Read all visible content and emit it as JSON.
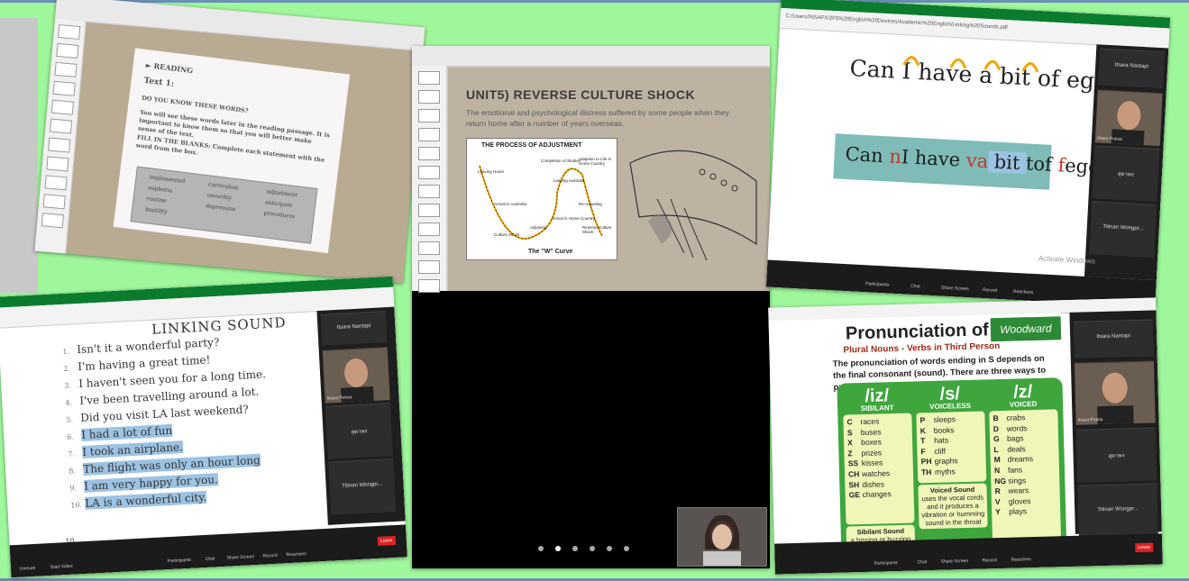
{
  "shot1": {
    "heading": "► READING",
    "text_label": "Text 1:",
    "q": "DO YOU KNOW THESE WORDS?",
    "intro": "You will see these words later in the reading passage. It is important to know them so that you will better make sense of the text.",
    "fill": "FILL IN THE BLANKS: Complete each statement with the word from the box.",
    "words": [
      "implemented",
      "curriculum",
      "adjustment",
      "euphoria",
      "smoothly",
      "anticipate",
      "routine",
      "depression",
      "procedures",
      "hostility"
    ]
  },
  "shot2": {
    "title": "UNIT5) REVERSE CULTURE SHOCK",
    "desc": "The emotional and psychological distress suffered by some people when they return home after a number of years overseas.",
    "diagram_title": "THE PROCESS OF ADJUSTMENT",
    "diagram_caption": "The \"W\" Curve",
    "diagram_labels": [
      "Leaving Home",
      "Arrival in Australia",
      "Adjusting",
      "Culture Shock",
      "Leaving Australia",
      "Arrival in Home Country",
      "Reverse Culture Shock",
      "Re-Adjusting",
      "Adaption to Life in Home Country",
      "Completion of Studies"
    ],
    "dots": 6,
    "active_dot": 1
  },
  "shot3": {
    "addr": "C:/Users/INSAFX/2F5%20English%20Devices/Academic%20English/Linking%20Sounds.pdf",
    "question": "Can I have a bit of egg?",
    "linked_parts": [
      "Can ",
      "n",
      "I have ",
      "va",
      " bit ",
      "tof ",
      "f",
      "egg?"
    ],
    "participants": [
      "Itsara Nantapi",
      "Itsara Puksa",
      "สุดาพร",
      "Titinan Wongpr..."
    ],
    "bottom": [
      "Participants",
      "Chat",
      "Share Screen",
      "Record",
      "Reactions"
    ],
    "watermark": "Activate Windows"
  },
  "shot4": {
    "title": "LINKING SOUND",
    "items": [
      {
        "n": "1.",
        "t": "Isn't it a wonderful party?"
      },
      {
        "n": "2.",
        "t": "I'm having a great time!"
      },
      {
        "n": "3.",
        "t": "I haven't seen you for a long time."
      },
      {
        "n": "4.",
        "t": "I've been travelling around a lot."
      },
      {
        "n": "5.",
        "t": "Did you visit LA last weekend?"
      },
      {
        "n": "6.",
        "t": "I had a lot of fun"
      },
      {
        "n": "7.",
        "t": "I took an airplane."
      },
      {
        "n": "8.",
        "t": "The flight was only an hour long"
      },
      {
        "n": "9.",
        "t": "I am very happy for you."
      },
      {
        "n": "10.",
        "t": "LA is a wonderful city."
      }
    ],
    "page": "10",
    "participants": [
      "Itsara Nantapi",
      "Itsara Puksa",
      "สุดาพร",
      "Titinan Wongpr..."
    ],
    "zoom_labels": [
      "Unmute",
      "Start Video",
      "Participants",
      "Chat",
      "Share Screen",
      "Record",
      "Reactions",
      "Leave"
    ]
  },
  "shot5": {
    "title": "Pronunciation of S",
    "subtitle": "Plural Nouns - Verbs in Third Person",
    "desc": "The pronunciation of words ending in S depends on the final consonant (sound). There are three ways to pronounce the S:",
    "badge": "Woodward",
    "cols": [
      {
        "sym": "/iz/",
        "label": "SIBILANT",
        "words": [
          [
            "C",
            "races"
          ],
          [
            "S",
            "buses"
          ],
          [
            "X",
            "boxes"
          ],
          [
            "Z",
            "prizes"
          ],
          [
            "SS",
            "kisses"
          ],
          [
            "CH",
            "watches"
          ],
          [
            "SH",
            "dishes"
          ],
          [
            "GE",
            "changes"
          ]
        ],
        "note_title": "Sibilant Sound",
        "note": "a hissing or buzzing sound"
      },
      {
        "sym": "/s/",
        "label": "VOICELESS",
        "words": [
          [
            "P",
            "sleeps"
          ],
          [
            "K",
            "books"
          ],
          [
            "T",
            "hats"
          ],
          [
            "F",
            "cliff"
          ],
          [
            "PH",
            "graphs"
          ],
          [
            "TH",
            "myths"
          ]
        ],
        "note_title": "Voiced Sound",
        "note": "uses the vocal cords and it produces a vibration or humming sound in the throat"
      },
      {
        "sym": "/z/",
        "label": "VOICED",
        "words": [
          [
            "B",
            "crabs"
          ],
          [
            "D",
            "words"
          ],
          [
            "G",
            "bags"
          ],
          [
            "L",
            "deals"
          ],
          [
            "M",
            "dreams"
          ],
          [
            "N",
            "fans"
          ],
          [
            "NG",
            "sings"
          ],
          [
            "R",
            "wears"
          ],
          [
            "V",
            "gloves"
          ],
          [
            "Y",
            "plays"
          ]
        ],
        "note_title": "",
        "note": ""
      }
    ],
    "participants": [
      "Itsara Nantapi",
      "Itsara Puksa",
      "สุดาพร",
      "Titinan Wongpr..."
    ],
    "bottom": [
      "Participants",
      "Chat",
      "Share Screen",
      "Record",
      "Reactions",
      "Leave"
    ]
  },
  "colors": {
    "background": "#9ff79b",
    "teal": "#7fbcb8",
    "highlight": "#9cc3e3",
    "green_panel": "#3ea63c",
    "arc": "#f0a500"
  }
}
